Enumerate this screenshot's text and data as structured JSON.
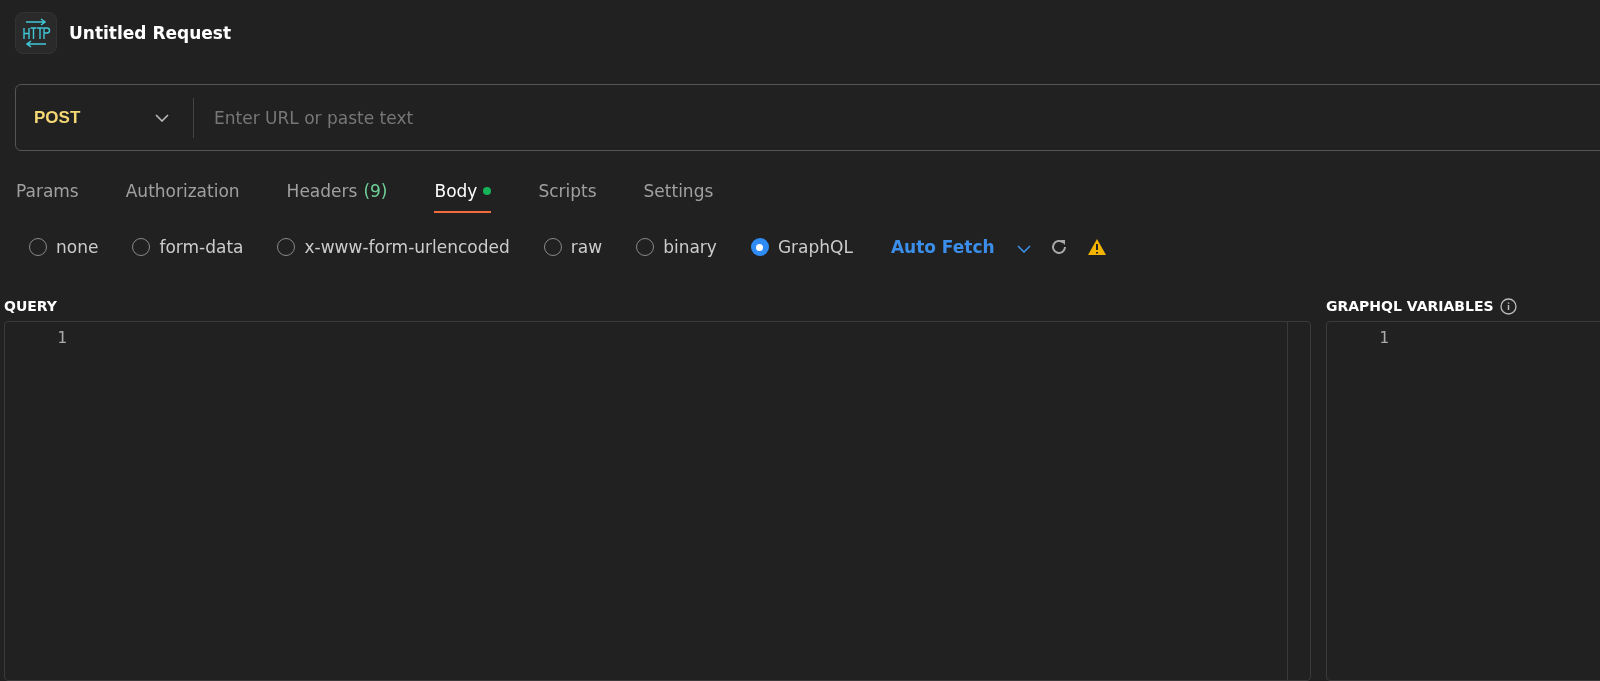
{
  "header": {
    "title": "Untitled Request"
  },
  "url_bar": {
    "method": "POST",
    "placeholder": "Enter URL or paste text"
  },
  "tabs": [
    {
      "label": "Params",
      "selected": false
    },
    {
      "label": "Authorization",
      "selected": false
    },
    {
      "label": "Headers",
      "count": "(9)",
      "selected": false
    },
    {
      "label": "Body",
      "has_content": true,
      "selected": true
    },
    {
      "label": "Scripts",
      "selected": false
    },
    {
      "label": "Settings",
      "selected": false
    }
  ],
  "body_types": [
    {
      "label": "none",
      "selected": false
    },
    {
      "label": "form-data",
      "selected": false
    },
    {
      "label": "x-www-form-urlencoded",
      "selected": false
    },
    {
      "label": "raw",
      "selected": false
    },
    {
      "label": "binary",
      "selected": false
    },
    {
      "label": "GraphQL",
      "selected": true
    }
  ],
  "auto_fetch": {
    "label": "Auto Fetch"
  },
  "query_editor": {
    "title": "QUERY",
    "line_numbers": [
      "1"
    ]
  },
  "variables_editor": {
    "title": "GRAPHQL VARIABLES",
    "line_numbers": [
      "1"
    ]
  }
}
